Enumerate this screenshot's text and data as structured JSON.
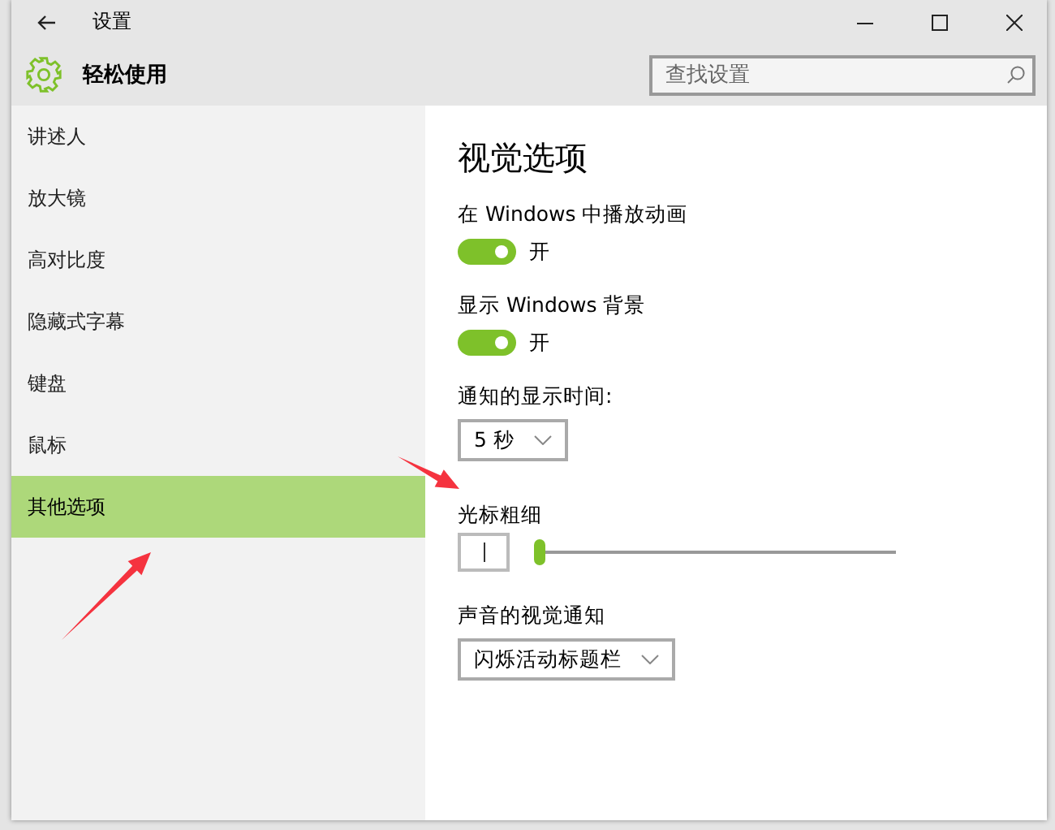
{
  "window": {
    "title": "设置"
  },
  "header": {
    "title": "轻松使用",
    "search": {
      "placeholder": "查找设置"
    }
  },
  "sidebar": {
    "items": [
      {
        "label": "讲述人",
        "selected": false
      },
      {
        "label": "放大镜",
        "selected": false
      },
      {
        "label": "高对比度",
        "selected": false
      },
      {
        "label": "隐藏式字幕",
        "selected": false
      },
      {
        "label": "键盘",
        "selected": false
      },
      {
        "label": "鼠标",
        "selected": false
      },
      {
        "label": "其他选项",
        "selected": true
      }
    ]
  },
  "content": {
    "title": "视觉选项",
    "settings": [
      {
        "kind": "toggle",
        "label": "在 Windows 中播放动画",
        "on": true,
        "state_text": "开"
      },
      {
        "kind": "toggle",
        "label": "显示 Windows 背景",
        "on": true,
        "state_text": "开"
      },
      {
        "kind": "dropdown",
        "label": "通知的显示时间:",
        "value": "5 秒"
      },
      {
        "kind": "slider",
        "label": "光标粗细",
        "level": 0
      },
      {
        "kind": "dropdown",
        "label": "声音的视觉通知",
        "value": "闪烁活动标题栏"
      }
    ]
  }
}
